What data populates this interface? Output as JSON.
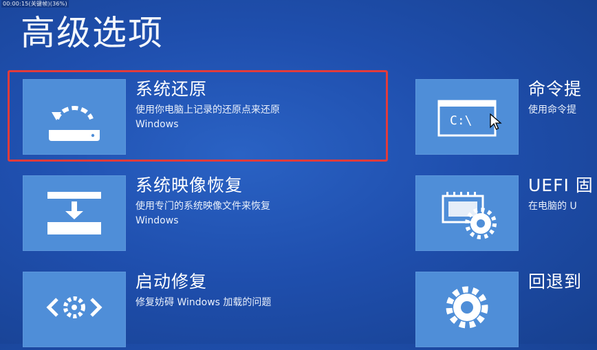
{
  "overlay": {
    "timestamp": "00:00:15(关键帧)(36%)"
  },
  "page": {
    "title": "高级选项"
  },
  "options": [
    {
      "name": "系统还原",
      "desc1": "使用你电脑上记录的还原点来还原",
      "desc2": "Windows",
      "icon": "restore-icon"
    },
    {
      "name": "系统映像恢复",
      "desc1": "使用专门的系统映像文件来恢复",
      "desc2": "Windows",
      "icon": "image-recovery-icon"
    },
    {
      "name": "启动修复",
      "desc1": "修复妨碍 Windows 加载的问题",
      "desc2": "",
      "icon": "startup-repair-icon"
    },
    {
      "name": "命令提",
      "desc1": "使用命令提",
      "desc2": "",
      "icon": "command-prompt-icon",
      "icon_text": "C:\\"
    },
    {
      "name": "UEFI 固",
      "desc1": "在电脑的 U",
      "desc2": "",
      "icon": "uefi-firmware-icon"
    },
    {
      "name": "回退到",
      "desc1": "",
      "desc2": "",
      "icon": "gear-icon"
    }
  ],
  "colors": {
    "background": "#1f4fae",
    "tile": "#4f8ed8",
    "highlight": "#e33b3b"
  }
}
